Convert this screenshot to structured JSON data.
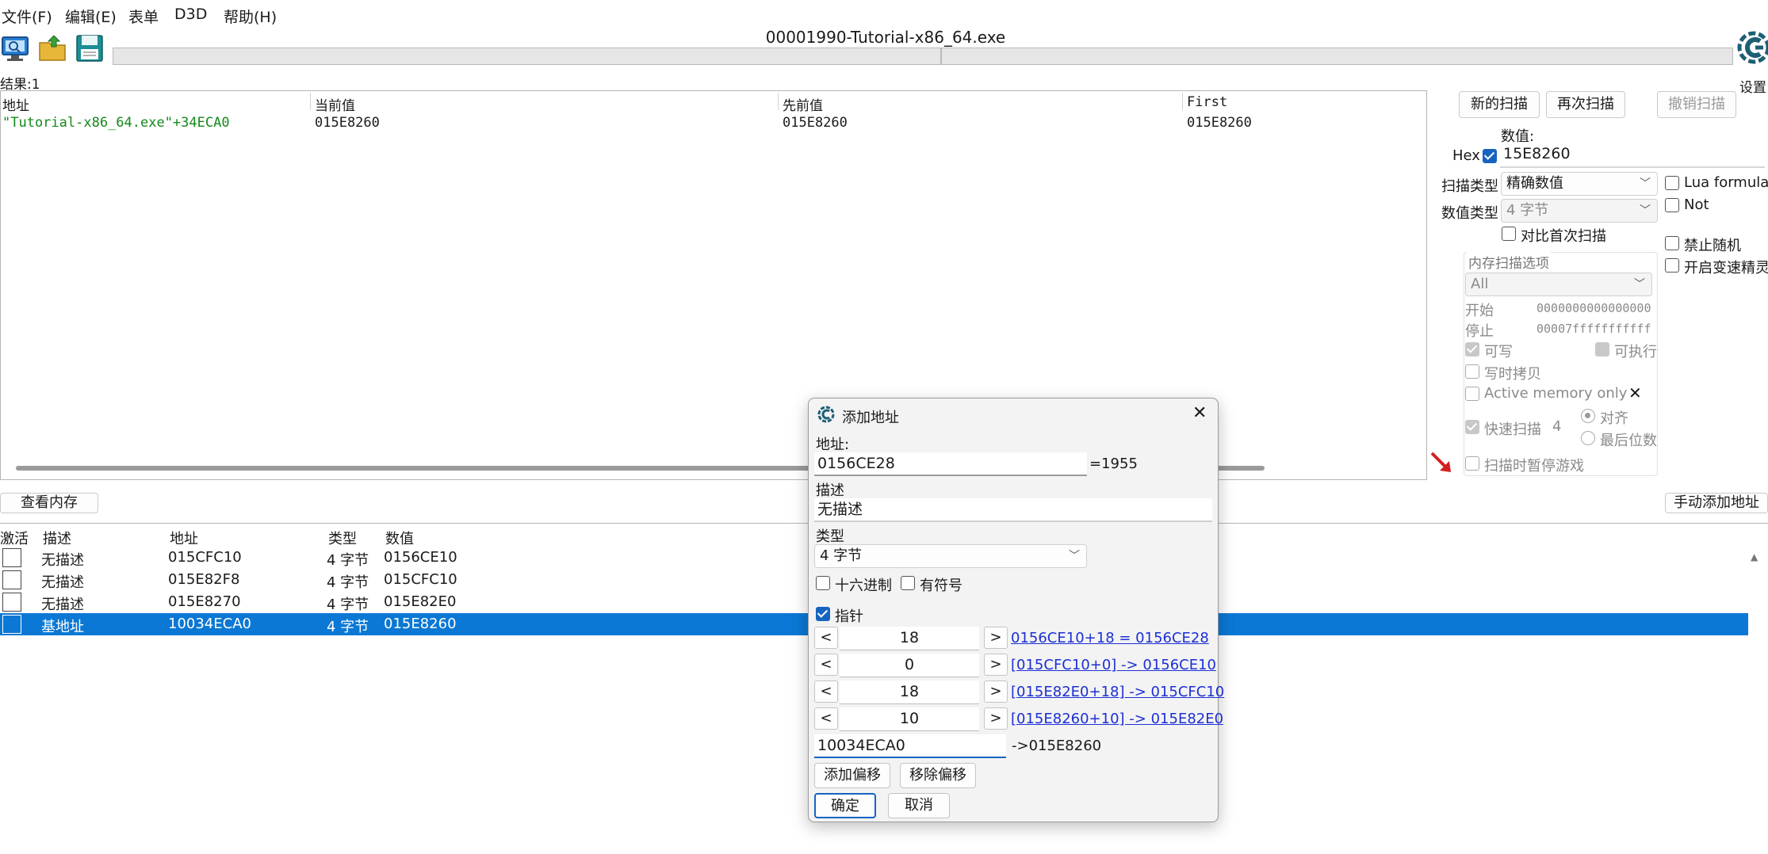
{
  "menu": [
    "文件(F)",
    "编辑(E)",
    "表单",
    "D3D",
    "帮助(H)"
  ],
  "toolbar": {
    "process_title": "00001990-Tutorial-x86_64.exe",
    "settings_label": "设置"
  },
  "results": {
    "count_label": "结果:1",
    "columns": [
      "地址",
      "当前值",
      "先前值",
      "First"
    ],
    "rows": [
      {
        "address": "\"Tutorial-x86_64.exe\"+34ECA0",
        "current": "015E8260",
        "previous": "015E8260",
        "first": "015E8260"
      }
    ]
  },
  "scan": {
    "new_scan": "新的扫描",
    "next_scan": "再次扫描",
    "undo_scan": "撤销扫描",
    "value_label": "数值:",
    "hex_label": "Hex",
    "value": "15E8260",
    "scan_type_label": "扫描类型",
    "scan_type": "精确数值",
    "value_type_label": "数值类型",
    "value_type": "4 字节",
    "compare_first": "对比首次扫描",
    "lua_formula": "Lua formula",
    "not": "Not",
    "no_random": "禁止随机",
    "speedhack": "开启变速精灵",
    "mem_options_title": "内存扫描选项",
    "mem_region": "All",
    "start_label": "开始",
    "start_value": "0000000000000000",
    "stop_label": "停止",
    "stop_value": "00007fffffffffff",
    "writable": "可写",
    "executable": "可执行",
    "copy_on_write": "写时拷贝",
    "active_memory": "Active memory only",
    "fast_scan": "快速扫描",
    "fast_scan_value": "4",
    "align": "对齐",
    "last_digits": "最后位数",
    "pause_game": "扫描时暂停游戏"
  },
  "address_list": {
    "view_memory": "查看内存",
    "add_manual": "手动添加地址",
    "columns": [
      "激活",
      "描述",
      "地址",
      "类型",
      "数值"
    ],
    "rows": [
      {
        "desc": "无描述",
        "address": "015CFC10",
        "type": "4 字节",
        "value": "0156CE10"
      },
      {
        "desc": "无描述",
        "address": "015E82F8",
        "type": "4 字节",
        "value": "015CFC10"
      },
      {
        "desc": "无描述",
        "address": "015E8270",
        "type": "4 字节",
        "value": "015E82E0"
      },
      {
        "desc": "基地址",
        "address": "10034ECA0",
        "type": "4 字节",
        "value": "015E8260"
      }
    ]
  },
  "dialog": {
    "title": "添加地址",
    "address_label": "地址:",
    "address_value": "0156CE28",
    "address_result": "=1955",
    "desc_label": "描述",
    "desc_value": "无描述",
    "type_label": "类型",
    "type_value": "4 字节",
    "hex_label": "十六进制",
    "signed_label": "有符号",
    "pointer_label": "指针",
    "offsets": [
      {
        "value": "18",
        "link": "0156CE10+18 = 0156CE28"
      },
      {
        "value": "0",
        "link": "[015CFC10+0] -> 0156CE10"
      },
      {
        "value": "18",
        "link": "[015E82E0+18] -> 015CFC10"
      },
      {
        "value": "10",
        "link": "[015E8260+10] -> 015E82E0"
      }
    ],
    "base_value": "10034ECA0",
    "base_result": "->015E8260",
    "add_offset": "添加偏移",
    "remove_offset": "移除偏移",
    "ok": "确定",
    "cancel": "取消",
    "dec": "<",
    "inc": ">"
  }
}
